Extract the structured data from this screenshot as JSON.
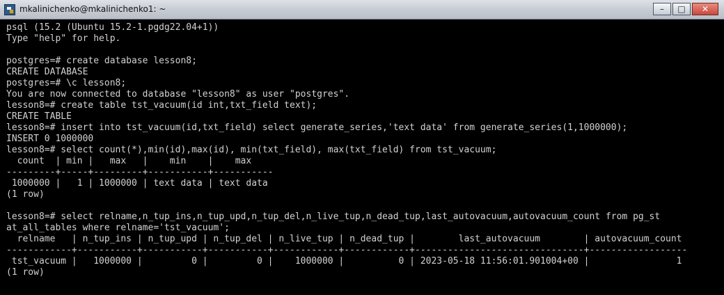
{
  "window": {
    "title": "mkalinichenko@mkalinichenko1: ~"
  },
  "controls": {
    "minimize": "–",
    "maximize": "□",
    "close": "✕"
  },
  "terminal": {
    "lines": [
      "psql (15.2 (Ubuntu 15.2-1.pgdg22.04+1))",
      "Type \"help\" for help.",
      "",
      "postgres=# create database lesson8;",
      "CREATE DATABASE",
      "postgres=# \\c lesson8;",
      "You are now connected to database \"lesson8\" as user \"postgres\".",
      "lesson8=# create table tst_vacuum(id int,txt_field text);",
      "CREATE TABLE",
      "lesson8=# insert into tst_vacuum(id,txt_field) select generate_series,'text data' from generate_series(1,1000000);",
      "INSERT 0 1000000",
      "lesson8=# select count(*),min(id),max(id), min(txt_field), max(txt_field) from tst_vacuum;",
      "  count  | min |   max   |    min    |    max",
      "---------+-----+---------+-----------+-----------",
      " 1000000 |   1 | 1000000 | text data | text data",
      "(1 row)",
      "",
      "lesson8=# select relname,n_tup_ins,n_tup_upd,n_tup_del,n_live_tup,n_dead_tup,last_autovacuum,autovacuum_count from pg_st",
      "at_all_tables where relname='tst_vacuum';",
      "  relname   | n_tup_ins | n_tup_upd | n_tup_del | n_live_tup | n_dead_tup |        last_autovacuum        | autovacuum_count",
      "------------+-----------+-----------+-----------+------------+------------+-------------------------------+------------------",
      " tst_vacuum |   1000000 |         0 |         0 |    1000000 |          0 | 2023-05-18 11:56:01.901004+00 |                1",
      "(1 row)"
    ]
  }
}
